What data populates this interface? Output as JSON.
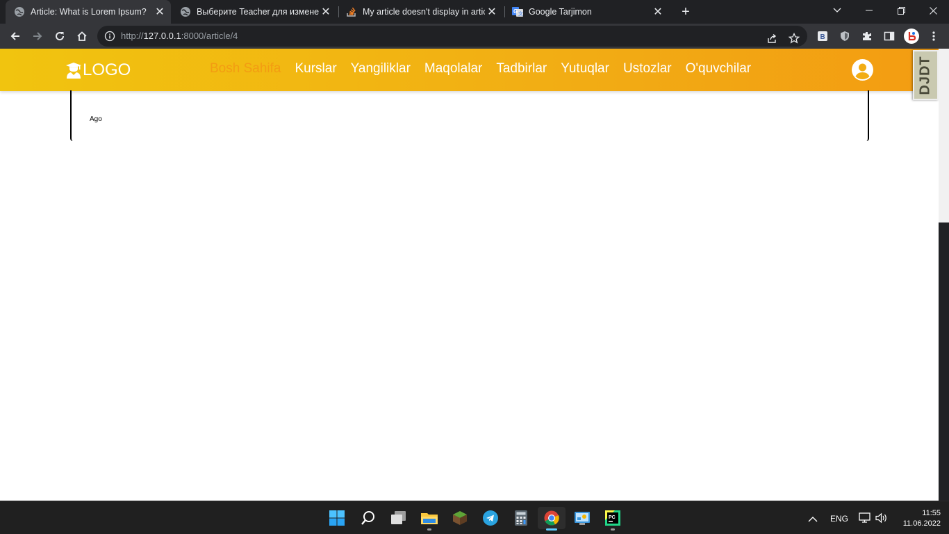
{
  "browser": {
    "tabs": [
      {
        "title": "Article: What is Lorem Ipsum?",
        "icon": "globe-icon",
        "active": true
      },
      {
        "title": "Выберите Teacher для изменения",
        "icon": "globe-icon",
        "active": false
      },
      {
        "title": "My article doesn't display in article",
        "icon": "stackoverflow-icon",
        "active": false
      },
      {
        "title": "Google Tarjimon",
        "icon": "google-translate-icon",
        "active": false
      }
    ],
    "url_prefix": "http://",
    "url_host": "127.0.0.1",
    "url_path": ":8000/article/4"
  },
  "site": {
    "logo_text": "LOGO",
    "nav": [
      "Bosh Sahifa",
      "Kurslar",
      "Yangiliklar",
      "Maqolalar",
      "Tadbirlar",
      "Yutuqlar",
      "Ustozlar",
      "O'quvchilar"
    ],
    "active_nav": "Bosh Sahifa",
    "accent_color": "#f39c12",
    "navbar_gradient": [
      "#f1c40f",
      "#f39c12"
    ]
  },
  "article": {
    "ago_text": "Ago"
  },
  "debug_toolbar": {
    "label": "DJDT"
  },
  "taskbar": {
    "tray": {
      "language": "ENG",
      "time": "11:55",
      "date": "11.06.2022"
    }
  }
}
